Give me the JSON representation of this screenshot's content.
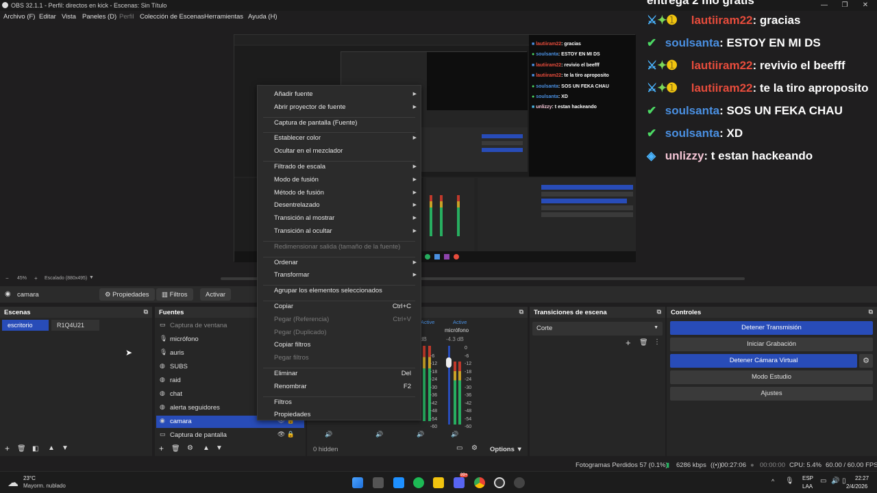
{
  "window": {
    "title": "OBS 32.1.1 - Perfil: directos en kick - Escenas: Sin Título",
    "min": "—",
    "max": "❐",
    "close": "✕"
  },
  "menu": [
    "Archivo (F)",
    "Editar",
    "Vista",
    "Paneles (D)",
    "Perfil",
    "Colección de Escenas",
    "Herramientas",
    "Ayuda (H)"
  ],
  "chat": {
    "header_cut": "entrega 2 mo gratis",
    "lines": [
      {
        "user": "lautiiram22",
        "text": ": gracias",
        "color": "red",
        "badge": "mod"
      },
      {
        "user": "soulsanta",
        "text": ": ESTOY EN MI DS",
        "color": "blue",
        "badge": "check"
      },
      {
        "user": "lautiiram22",
        "text": ": revivio el beefff",
        "color": "red",
        "badge": "mod"
      },
      {
        "user": "lautiiram22",
        "text": ": te la tiro aproposito",
        "color": "red",
        "badge": "mod"
      },
      {
        "user": "soulsanta",
        "text": ": SOS UN FEKA CHAU",
        "color": "blue",
        "badge": "check"
      },
      {
        "user": "soulsanta",
        "text": ": XD",
        "color": "blue",
        "badge": "check"
      },
      {
        "user": "unlizzy",
        "text": ": t estan hackeando",
        "color": "pink",
        "badge": "cube"
      }
    ]
  },
  "nested_chat": [
    {
      "user": "lautiiram22",
      "text": ": gracias"
    },
    {
      "user": "soulsanta",
      "text": ": ESTOY EN MI DS"
    },
    {
      "user": "lautiiram22",
      "text": ": revivio el beefff"
    },
    {
      "user": "lautiiram22",
      "text": ": te la tiro aproposito"
    },
    {
      "user": "soulsanta",
      "text": ": SOS UN FEKA CHAU"
    },
    {
      "user": "soulsanta",
      "text": ": XD"
    },
    {
      "user": "unlizzy",
      "text": ": t estan hackeando"
    }
  ],
  "preview_status": {
    "zoom": "45%",
    "scale": "Escalado (880x495)"
  },
  "source_toolbar": {
    "selected": "camara",
    "properties": "Propiedades",
    "filters": "Filtros",
    "activate": "Activar"
  },
  "scenes": {
    "title": "Escenas",
    "items": [
      "escritorio",
      "R1Q4U21"
    ]
  },
  "sources": {
    "title": "Fuentes",
    "items": [
      {
        "name": "Captura de ventana",
        "icon": "window-icon",
        "glyph": "▭",
        "dim": true
      },
      {
        "name": "micrófono",
        "icon": "mic-icon",
        "glyph": "🎙",
        "dim": false
      },
      {
        "name": "auris",
        "icon": "mic-icon",
        "glyph": "🎙",
        "dim": false
      },
      {
        "name": "SUBS",
        "icon": "globe-icon",
        "glyph": "◍",
        "dim": false
      },
      {
        "name": "raid",
        "icon": "globe-icon",
        "glyph": "◍",
        "dim": false
      },
      {
        "name": "chat",
        "icon": "globe-icon",
        "glyph": "◍",
        "dim": false
      },
      {
        "name": "alerta seguidores",
        "icon": "globe-icon",
        "glyph": "◍",
        "dim": false
      },
      {
        "name": "camara",
        "icon": "camera-icon",
        "glyph": "◉",
        "dim": false,
        "selected": true
      },
      {
        "name": "Captura de pantalla",
        "icon": "monitor-icon",
        "glyph": "▭",
        "dim": false
      }
    ]
  },
  "mixer": {
    "hidden_label": "0 hidden",
    "options": "Options",
    "active": "Active",
    "db": "-4.3 dB",
    "db2": "dB",
    "channel": "micrófono",
    "ticks": [
      "0",
      "-6",
      "-12",
      "-18",
      "-24",
      "-30",
      "-36",
      "-42",
      "-48",
      "-54",
      "-60"
    ]
  },
  "transitions": {
    "title": "Transiciones de escena",
    "value": "Corte"
  },
  "controls": {
    "title": "Controles",
    "buttons": [
      {
        "label": "Detener Transmisión",
        "blue": true
      },
      {
        "label": "Iniciar Grabación",
        "blue": false
      },
      {
        "label": "Detener Cámara Virtual",
        "blue": true
      },
      {
        "label": "Modo Estudio",
        "blue": false
      },
      {
        "label": "Ajustes",
        "blue": false
      }
    ]
  },
  "context_menu": [
    {
      "label": "Añadir fuente",
      "arrow": true
    },
    {
      "label": "Abrir proyector de fuente",
      "arrow": true
    },
    {
      "sep": true
    },
    {
      "label": "Captura de pantalla (Fuente)"
    },
    {
      "sep": true
    },
    {
      "label": "Establecer color",
      "arrow": true
    },
    {
      "label": "Ocultar en el mezclador"
    },
    {
      "sep": true
    },
    {
      "label": "Filtrado de escala",
      "arrow": true
    },
    {
      "label": "Modo de fusión",
      "arrow": true
    },
    {
      "label": "Método de fusión",
      "arrow": true
    },
    {
      "label": "Desentrelazado",
      "arrow": true
    },
    {
      "label": "Transición al mostrar",
      "arrow": true
    },
    {
      "label": "Transición al ocultar",
      "arrow": true
    },
    {
      "sep": true
    },
    {
      "label": "Redimensionar salida (tamaño de la fuente)",
      "dim": true
    },
    {
      "sep": true
    },
    {
      "label": "Ordenar",
      "arrow": true
    },
    {
      "label": "Transformar",
      "arrow": true
    },
    {
      "sep": true
    },
    {
      "label": "Agrupar los elementos seleccionados"
    },
    {
      "sep": true
    },
    {
      "label": "Copiar",
      "shortcut": "Ctrl+C"
    },
    {
      "label": "Pegar (Referencia)",
      "shortcut": "Ctrl+V",
      "dim": true
    },
    {
      "label": "Pegar (Duplicado)",
      "dim": true
    },
    {
      "label": "Copiar filtros"
    },
    {
      "label": "Pegar filtros",
      "dim": true
    },
    {
      "sep": true
    },
    {
      "label": "Eliminar",
      "shortcut": "Del"
    },
    {
      "label": "Renombrar",
      "shortcut": "F2"
    },
    {
      "sep": true
    },
    {
      "label": "Filtros"
    },
    {
      "label": "Propiedades"
    }
  ],
  "status": {
    "dropped": "Fotogramas Perdidos 57 (0.1%)",
    "kbps": "6286 kbps",
    "stream_time": "00:27:06",
    "rec_time": "00:00:00",
    "cpu": "CPU: 5.4%",
    "fps": "60.00 / 60.00 FPS"
  },
  "taskbar": {
    "temp": "23°C",
    "weather": "Mayorm. nublado",
    "lang1": "ESP",
    "lang2": "LAA",
    "time": "22:27",
    "date": "2/4/2026",
    "badge": "99+"
  }
}
